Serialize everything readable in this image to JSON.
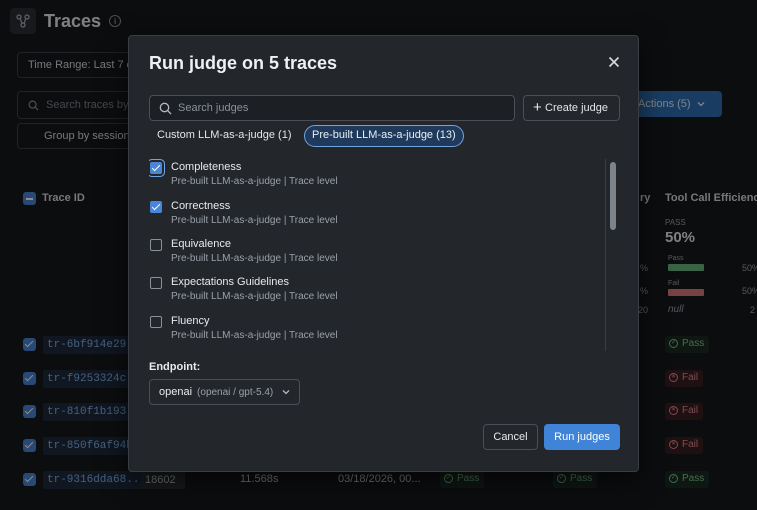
{
  "page": {
    "title": "Traces",
    "time_range": "Time Range: Last 7 d",
    "search_placeholder": "Search traces by",
    "group_label": "Group by session",
    "actions_label": "Actions (5)"
  },
  "table": {
    "headers": {
      "trace_id": "Trace ID",
      "col_partial": "ry",
      "tool_call": "Tool Call Efficiency"
    },
    "metric": {
      "pass_label": "PASS",
      "pass_value": "50%",
      "bar_pass_label": "Pass",
      "bar_fail_label": "Fail",
      "pass_pct": "50%",
      "fail_pct": "50%",
      "side_pass_pct": "%",
      "side_fail_pct": "%",
      "side_num": "20",
      "null_value": "null",
      "right_num": "2"
    },
    "rows": [
      {
        "trace_id": "tr-6bf914e29...",
        "tool_call": "Pass"
      },
      {
        "trace_id": "tr-f9253324c...",
        "tool_call": "Fail"
      },
      {
        "trace_id": "tr-810f1b193...",
        "tool_call": "Fail"
      },
      {
        "trace_id": "tr-850f6af94b...",
        "tool_call": "Fail"
      },
      {
        "trace_id": "tr-9316dda68...",
        "id_value": "18602",
        "duration": "11.568s",
        "timestamp": "03/18/2026, 00...",
        "col_a": "Pass",
        "col_b": "Pass",
        "tool_call": "Pass"
      }
    ]
  },
  "modal": {
    "title": "Run judge on 5 traces",
    "search_placeholder": "Search judges",
    "create_label": "Create judge",
    "tabs": [
      {
        "label": "Custom LLM-as-a-judge (1)",
        "active": false
      },
      {
        "label": "Pre-built LLM-as-a-judge (13)",
        "active": true
      }
    ],
    "judges": [
      {
        "name": "Completeness",
        "sub": "Pre-built LLM-as-a-judge | Trace level",
        "checked": true
      },
      {
        "name": "Correctness",
        "sub": "Pre-built LLM-as-a-judge | Trace level",
        "checked": true
      },
      {
        "name": "Equivalence",
        "sub": "Pre-built LLM-as-a-judge | Trace level",
        "checked": false
      },
      {
        "name": "Expectations Guidelines",
        "sub": "Pre-built LLM-as-a-judge | Trace level",
        "checked": false
      },
      {
        "name": "Fluency",
        "sub": "Pre-built LLM-as-a-judge | Trace level",
        "checked": false
      }
    ],
    "endpoint_label": "Endpoint:",
    "endpoint_name": "openai",
    "endpoint_model": "(openai / gpt-5.4)",
    "cancel_label": "Cancel",
    "run_label": "Run judges"
  },
  "colors": {
    "accent": "#3f84d6",
    "pass": "#7cc98e",
    "fail": "#ea8a8f",
    "modal_bg": "#23262b"
  }
}
